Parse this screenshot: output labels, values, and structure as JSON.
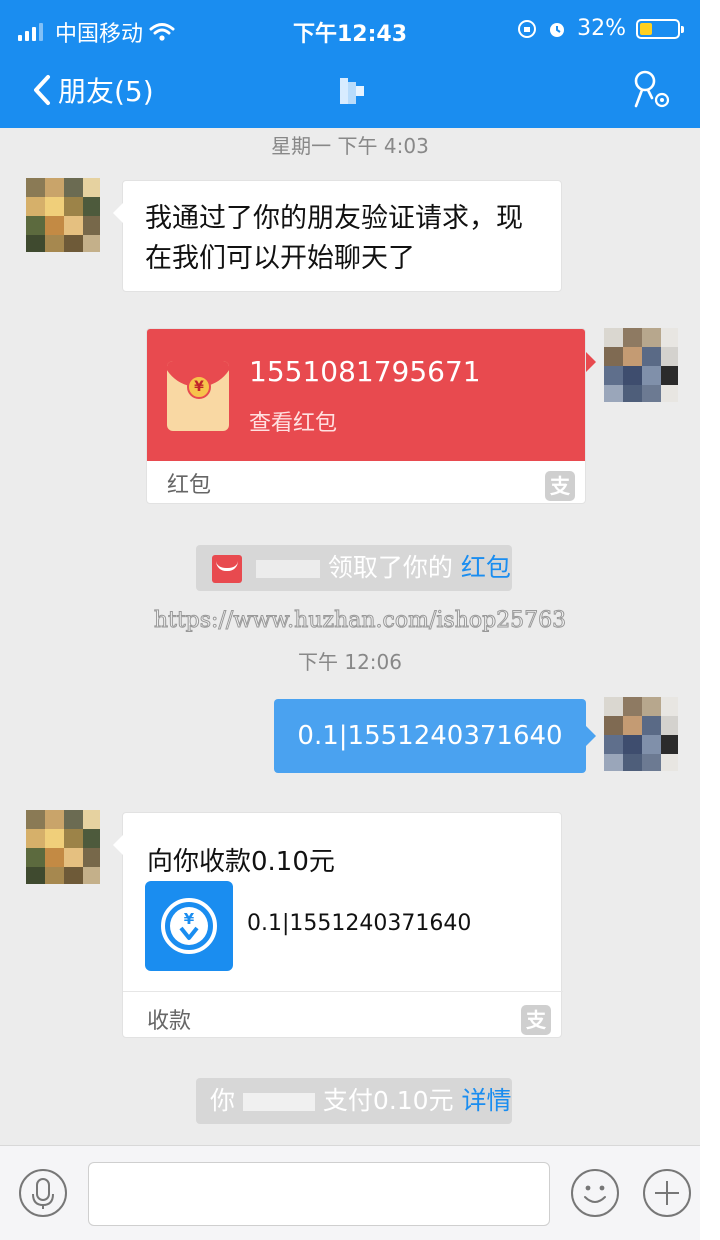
{
  "status_bar": {
    "carrier": "中国移动",
    "time": "下午12:43",
    "battery": "32%",
    "battery_level": 0.32
  },
  "nav": {
    "back_label": "朋友(5)"
  },
  "messages": {
    "timestamp_1": "星期一 下午 4:03",
    "friend_text": "我通过了你的朋友验证请求，现在我们可以开始聊天了",
    "red_packet": {
      "number": "1551081795671",
      "action": "查看红包",
      "footer": "红包"
    },
    "system_red_packet": {
      "text": "领取了你的",
      "link": "红包"
    },
    "watermark": "https://www.huzhan.com/ishop25763",
    "timestamp_2": "下午 12:06",
    "sent_text": "0.1|1551240371640",
    "collect": {
      "title": "向你收款0.10元",
      "value": "0.1|1551240371640",
      "footer": "收款"
    },
    "system_payment": {
      "prefix": "你",
      "text": "支付0.10元",
      "link": "详情"
    }
  },
  "input": {
    "placeholder": ""
  },
  "colors": {
    "brand_blue": "#1a8df0",
    "red_packet": "#e84a4f",
    "sent_bubble": "#4aa2f0"
  }
}
